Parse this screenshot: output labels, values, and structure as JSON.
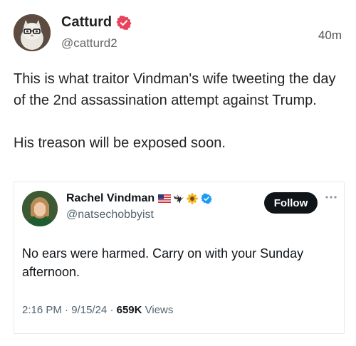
{
  "post": {
    "author_name": "Catturd",
    "author_handle": "@catturd2",
    "timestamp": "40m",
    "paragraphs": [
      "This is what traitor Vindman's wife tweeting the day of the 2nd assassination attempt against Trump.",
      "His treason will be exposed soon."
    ],
    "verified_color": "#e8435a"
  },
  "embedded_tweet": {
    "author_name": "Rachel Vindman",
    "author_handle": "@natsechobbyist",
    "name_emojis": [
      "us-flag-icon",
      "eagle-icon",
      "sunflower-icon"
    ],
    "follow_label": "Follow",
    "text": "No ears were harmed. Carry on with your Sunday afternoon.",
    "time": "2:16 PM",
    "date": "9/15/24",
    "views_count": "659K",
    "views_label": "Views",
    "separator": "·",
    "verified_color": "#1d9bf0"
  }
}
